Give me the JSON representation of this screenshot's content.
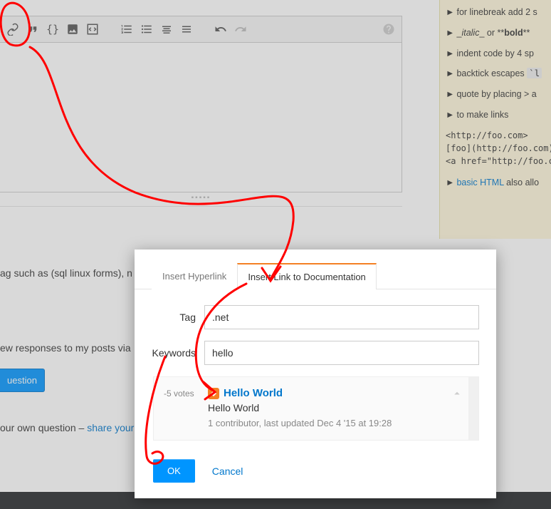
{
  "toolbar": {
    "icons": [
      "link",
      "quote",
      "code",
      "image",
      "snippet",
      "ol",
      "ul",
      "heading",
      "hr",
      "undo",
      "redo",
      "help"
    ]
  },
  "grip": "▪▪▪▪▪",
  "help": {
    "rows": {
      "linebreak": "for linebreak add 2 s",
      "italic_pre": "_",
      "italic_word": "italic",
      "italic_post": "_ or **",
      "bold_word": "bold",
      "bold_post": "**",
      "indent": "indent code by 4 sp",
      "backtick": "backtick escapes ",
      "backtick_code": "`l",
      "quote": "quote by placing > a",
      "links": "to make links"
    },
    "examples": {
      "l1": "<http://foo.com>",
      "l2": "[foo](http://foo.com)",
      "l3": "<a href=\"http://foo.com"
    },
    "basic_html_pre": "basic HTML",
    "basic_html_post": " also allo"
  },
  "lower": {
    "tag_hint": "ag such as (sql linux forms), n",
    "responses": "ew responses to my posts via",
    "ask_button": "uestion",
    "own_pre": "our own question – ",
    "own_link": "share your k"
  },
  "modal": {
    "tabs": {
      "hyperlink": "Insert Hyperlink",
      "doc": "Insert Link to Documentation"
    },
    "labels": {
      "tag": "Tag",
      "keywords": "Keywords"
    },
    "values": {
      "tag": ".net",
      "keywords": "hello"
    },
    "result": {
      "votes": "-5 votes",
      "title": "Hello World",
      "sub": "Hello World",
      "meta": "1 contributor, last updated Dec 4 '15 at 19:28"
    },
    "actions": {
      "ok": "OK",
      "cancel": "Cancel"
    }
  }
}
